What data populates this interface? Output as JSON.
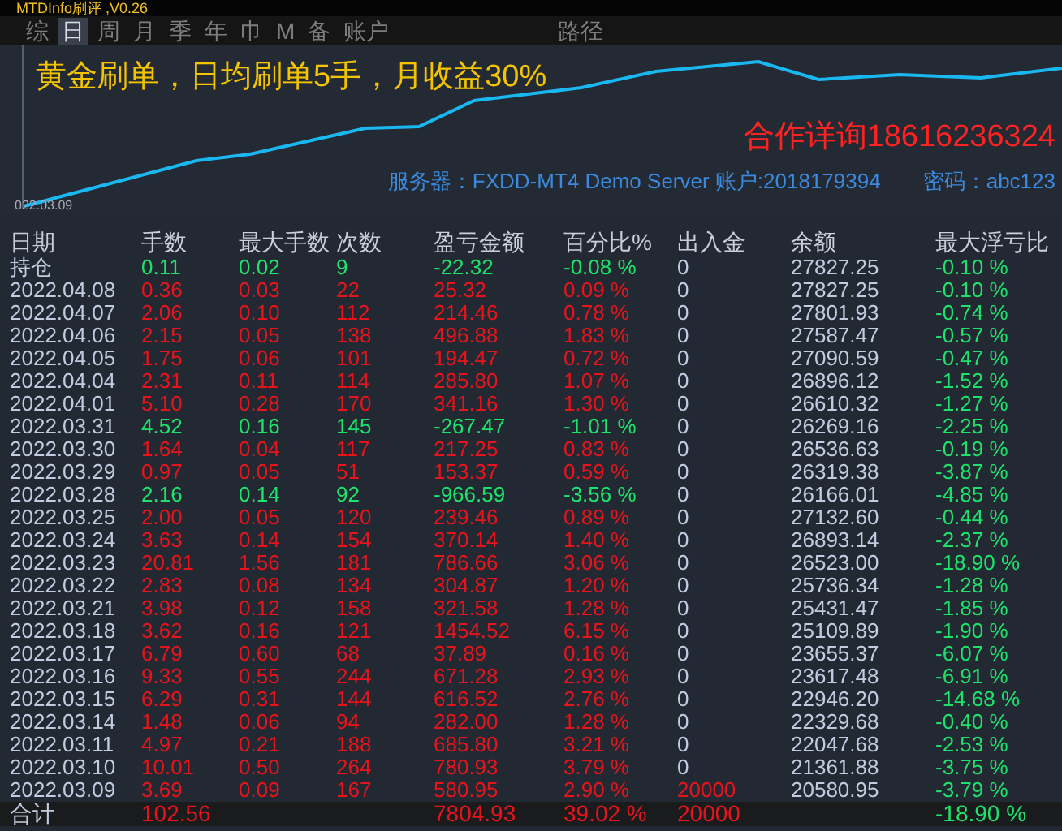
{
  "window": {
    "title": "MTDInfo刷评 ,V0.26"
  },
  "tabs": [
    {
      "label": "综",
      "selected": false
    },
    {
      "label": "日",
      "selected": true
    },
    {
      "label": "周",
      "selected": false
    },
    {
      "label": "月",
      "selected": false
    },
    {
      "label": "季",
      "selected": false
    },
    {
      "label": "年",
      "selected": false
    },
    {
      "label": "巾",
      "selected": false
    },
    {
      "label": "M",
      "selected": false
    },
    {
      "label": "备",
      "selected": false
    },
    {
      "label": "账户",
      "selected": false
    },
    {
      "label": "路径",
      "selected": false
    }
  ],
  "chart": {
    "headline": "黄金刷单，日均刷单5手，月收益30%",
    "contact": "合作详询18616236324",
    "server": "服务器：FXDD-MT4 Demo Server 账户:2018179394",
    "password": "密码：abc123",
    "start_label": "022.03.09"
  },
  "table": {
    "columns": [
      "日期",
      "手数",
      "最大手数",
      "次数",
      "盈亏金额",
      "百分比%",
      "出入金",
      "余额",
      "最大浮亏比"
    ],
    "rows": [
      {
        "date": "持仓",
        "lots": "0.11",
        "max_lots": "0.02",
        "count": "9",
        "pnl": "-22.32",
        "pct": "-0.08 %",
        "deposit": "0",
        "balance": "27827.25",
        "max_dd": "-0.10 %",
        "color": "#1ee36b",
        "deposit_highlight": false
      },
      {
        "date": "2022.04.08",
        "lots": "0.36",
        "max_lots": "0.03",
        "count": "22",
        "pnl": "25.32",
        "pct": "0.09 %",
        "deposit": "0",
        "balance": "27827.25",
        "max_dd": "-0.10 %",
        "color": "#e8141c",
        "deposit_highlight": false
      },
      {
        "date": "2022.04.07",
        "lots": "2.06",
        "max_lots": "0.10",
        "count": "112",
        "pnl": "214.46",
        "pct": "0.78 %",
        "deposit": "0",
        "balance": "27801.93",
        "max_dd": "-0.74 %",
        "color": "#e8141c",
        "deposit_highlight": false
      },
      {
        "date": "2022.04.06",
        "lots": "2.15",
        "max_lots": "0.05",
        "count": "138",
        "pnl": "496.88",
        "pct": "1.83 %",
        "deposit": "0",
        "balance": "27587.47",
        "max_dd": "-0.57 %",
        "color": "#e8141c",
        "deposit_highlight": false
      },
      {
        "date": "2022.04.05",
        "lots": "1.75",
        "max_lots": "0.06",
        "count": "101",
        "pnl": "194.47",
        "pct": "0.72 %",
        "deposit": "0",
        "balance": "27090.59",
        "max_dd": "-0.47 %",
        "color": "#e8141c",
        "deposit_highlight": false
      },
      {
        "date": "2022.04.04",
        "lots": "2.31",
        "max_lots": "0.11",
        "count": "114",
        "pnl": "285.80",
        "pct": "1.07 %",
        "deposit": "0",
        "balance": "26896.12",
        "max_dd": "-1.52 %",
        "color": "#e8141c",
        "deposit_highlight": false
      },
      {
        "date": "2022.04.01",
        "lots": "5.10",
        "max_lots": "0.28",
        "count": "170",
        "pnl": "341.16",
        "pct": "1.30 %",
        "deposit": "0",
        "balance": "26610.32",
        "max_dd": "-1.27 %",
        "color": "#e8141c",
        "deposit_highlight": false
      },
      {
        "date": "2022.03.31",
        "lots": "4.52",
        "max_lots": "0.16",
        "count": "145",
        "pnl": "-267.47",
        "pct": "-1.01 %",
        "deposit": "0",
        "balance": "26269.16",
        "max_dd": "-2.25 %",
        "color": "#1ee36b",
        "deposit_highlight": false
      },
      {
        "date": "2022.03.30",
        "lots": "1.64",
        "max_lots": "0.04",
        "count": "117",
        "pnl": "217.25",
        "pct": "0.83 %",
        "deposit": "0",
        "balance": "26536.63",
        "max_dd": "-0.19 %",
        "color": "#e8141c",
        "deposit_highlight": false
      },
      {
        "date": "2022.03.29",
        "lots": "0.97",
        "max_lots": "0.05",
        "count": "51",
        "pnl": "153.37",
        "pct": "0.59 %",
        "deposit": "0",
        "balance": "26319.38",
        "max_dd": "-3.87 %",
        "color": "#e8141c",
        "deposit_highlight": false
      },
      {
        "date": "2022.03.28",
        "lots": "2.16",
        "max_lots": "0.14",
        "count": "92",
        "pnl": "-966.59",
        "pct": "-3.56 %",
        "deposit": "0",
        "balance": "26166.01",
        "max_dd": "-4.85 %",
        "color": "#1ee36b",
        "deposit_highlight": false
      },
      {
        "date": "2022.03.25",
        "lots": "2.00",
        "max_lots": "0.05",
        "count": "120",
        "pnl": "239.46",
        "pct": "0.89 %",
        "deposit": "0",
        "balance": "27132.60",
        "max_dd": "-0.44 %",
        "color": "#e8141c",
        "deposit_highlight": false
      },
      {
        "date": "2022.03.24",
        "lots": "3.63",
        "max_lots": "0.14",
        "count": "154",
        "pnl": "370.14",
        "pct": "1.40 %",
        "deposit": "0",
        "balance": "26893.14",
        "max_dd": "-2.37 %",
        "color": "#e8141c",
        "deposit_highlight": false
      },
      {
        "date": "2022.03.23",
        "lots": "20.81",
        "max_lots": "1.56",
        "count": "181",
        "pnl": "786.66",
        "pct": "3.06 %",
        "deposit": "0",
        "balance": "26523.00",
        "max_dd": "-18.90 %",
        "color": "#e8141c",
        "deposit_highlight": false
      },
      {
        "date": "2022.03.22",
        "lots": "2.83",
        "max_lots": "0.08",
        "count": "134",
        "pnl": "304.87",
        "pct": "1.20 %",
        "deposit": "0",
        "balance": "25736.34",
        "max_dd": "-1.28 %",
        "color": "#e8141c",
        "deposit_highlight": false
      },
      {
        "date": "2022.03.21",
        "lots": "3.98",
        "max_lots": "0.12",
        "count": "158",
        "pnl": "321.58",
        "pct": "1.28 %",
        "deposit": "0",
        "balance": "25431.47",
        "max_dd": "-1.85 %",
        "color": "#e8141c",
        "deposit_highlight": false
      },
      {
        "date": "2022.03.18",
        "lots": "3.62",
        "max_lots": "0.16",
        "count": "121",
        "pnl": "1454.52",
        "pct": "6.15 %",
        "deposit": "0",
        "balance": "25109.89",
        "max_dd": "-1.90 %",
        "color": "#e8141c",
        "deposit_highlight": false
      },
      {
        "date": "2022.03.17",
        "lots": "6.79",
        "max_lots": "0.60",
        "count": "68",
        "pnl": "37.89",
        "pct": "0.16 %",
        "deposit": "0",
        "balance": "23655.37",
        "max_dd": "-6.07 %",
        "color": "#e8141c",
        "deposit_highlight": false
      },
      {
        "date": "2022.03.16",
        "lots": "9.33",
        "max_lots": "0.55",
        "count": "244",
        "pnl": "671.28",
        "pct": "2.93 %",
        "deposit": "0",
        "balance": "23617.48",
        "max_dd": "-6.91 %",
        "color": "#e8141c",
        "deposit_highlight": false
      },
      {
        "date": "2022.03.15",
        "lots": "6.29",
        "max_lots": "0.31",
        "count": "144",
        "pnl": "616.52",
        "pct": "2.76 %",
        "deposit": "0",
        "balance": "22946.20",
        "max_dd": "-14.68 %",
        "color": "#e8141c",
        "deposit_highlight": false
      },
      {
        "date": "2022.03.14",
        "lots": "1.48",
        "max_lots": "0.06",
        "count": "94",
        "pnl": "282.00",
        "pct": "1.28 %",
        "deposit": "0",
        "balance": "22329.68",
        "max_dd": "-0.40 %",
        "color": "#e8141c",
        "deposit_highlight": false
      },
      {
        "date": "2022.03.11",
        "lots": "4.97",
        "max_lots": "0.21",
        "count": "188",
        "pnl": "685.80",
        "pct": "3.21 %",
        "deposit": "0",
        "balance": "22047.68",
        "max_dd": "-2.53 %",
        "color": "#e8141c",
        "deposit_highlight": false
      },
      {
        "date": "2022.03.10",
        "lots": "10.01",
        "max_lots": "0.50",
        "count": "264",
        "pnl": "780.93",
        "pct": "3.79 %",
        "deposit": "0",
        "balance": "21361.88",
        "max_dd": "-3.75 %",
        "color": "#e8141c",
        "deposit_highlight": false
      },
      {
        "date": "2022.03.09",
        "lots": "3.69",
        "max_lots": "0.09",
        "count": "167",
        "pnl": "580.95",
        "pct": "2.90 %",
        "deposit": "20000",
        "balance": "20580.95",
        "max_dd": "-3.79 %",
        "color": "#e8141c",
        "deposit_highlight": true
      }
    ],
    "total": {
      "date": "合计",
      "lots": "102.56",
      "pnl": "7804.93",
      "pct": "39.02 %",
      "deposit": "20000",
      "max_dd": "-18.90 %",
      "color": "#e8141c",
      "deposit_highlight": true
    }
  }
}
